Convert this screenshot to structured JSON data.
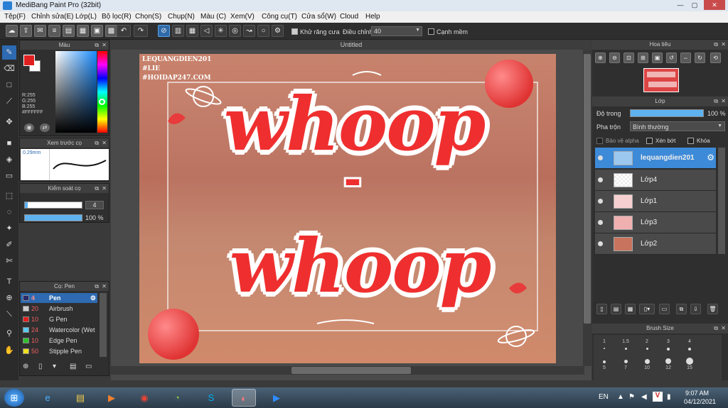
{
  "window": {
    "title": "MediBang Paint Pro (32bit)"
  },
  "menu": [
    "Tệp(F)",
    "Chỉnh sửa(E)",
    "Lớp(L)",
    "Bộ lọc(R)",
    "Chọn(S)",
    "Chụp(N)",
    "Màu (C)",
    "Xem(V)",
    "Công cụ(T)",
    "Cửa sổ(W)",
    "Cloud",
    "Help"
  ],
  "options": {
    "antialias_label": "Khử răng cưa",
    "adjust_label": "Điều chỉnh",
    "adjust_value": "40",
    "sharp_label": "Cạnh mềm"
  },
  "color_panel": {
    "title": "Màu",
    "r": "R:255",
    "g": "G:255",
    "b": "B:255",
    "hex": "#FFFFFF"
  },
  "preview_panel": {
    "title": "Xem trước cọ",
    "size": "0.29mm"
  },
  "brush_control": {
    "title": "Kiểm soát cọ",
    "size": "4",
    "opacity": "100 %"
  },
  "brush_panel": {
    "title": "Cọ: Pen",
    "items": [
      {
        "size": "4",
        "name": "Pen",
        "color": "#2a2a6a"
      },
      {
        "size": "20",
        "name": "Airbrush",
        "color": "#cccccc"
      },
      {
        "size": "10",
        "name": "G Pen",
        "color": "#e02020"
      },
      {
        "size": "24",
        "name": "Watercolor (Wet",
        "color": "#5ac8f0"
      },
      {
        "size": "10",
        "name": "Edge Pen",
        "color": "#30c030"
      },
      {
        "size": "50",
        "name": "Stipple Pen",
        "color": "#f0e020"
      }
    ]
  },
  "canvas": {
    "tab": "Untitled",
    "watermark": [
      "LEQUANGDIEN201",
      "#LIE",
      "#HOIDAP247.COM"
    ],
    "word1": "whoop",
    "dash": "-",
    "word2": "whoop"
  },
  "navigator": {
    "title": "Hoa tiêu"
  },
  "layer_panel": {
    "title": "Lớp",
    "opacity_label": "Độ trong",
    "opacity_value": "100 %",
    "blend_label": "Pha trộn",
    "blend_value": "Bình thường",
    "alpha_label": "Bảo vệ alpha",
    "clip_label": "Xén bớt",
    "lock_label": "Khóa",
    "layers": [
      "lequangdien201",
      "Lớp4",
      "Lớp1",
      "Lớp3",
      "Lớp2"
    ]
  },
  "brush_size": {
    "title": "Brush Size",
    "sizes": [
      "1",
      "1.5",
      "2",
      "3",
      "4",
      "5",
      "7",
      "10",
      "12",
      "15"
    ]
  },
  "taskbar": {
    "lang": "EN",
    "time": "9:07 AM",
    "date": "04/12/2021"
  }
}
